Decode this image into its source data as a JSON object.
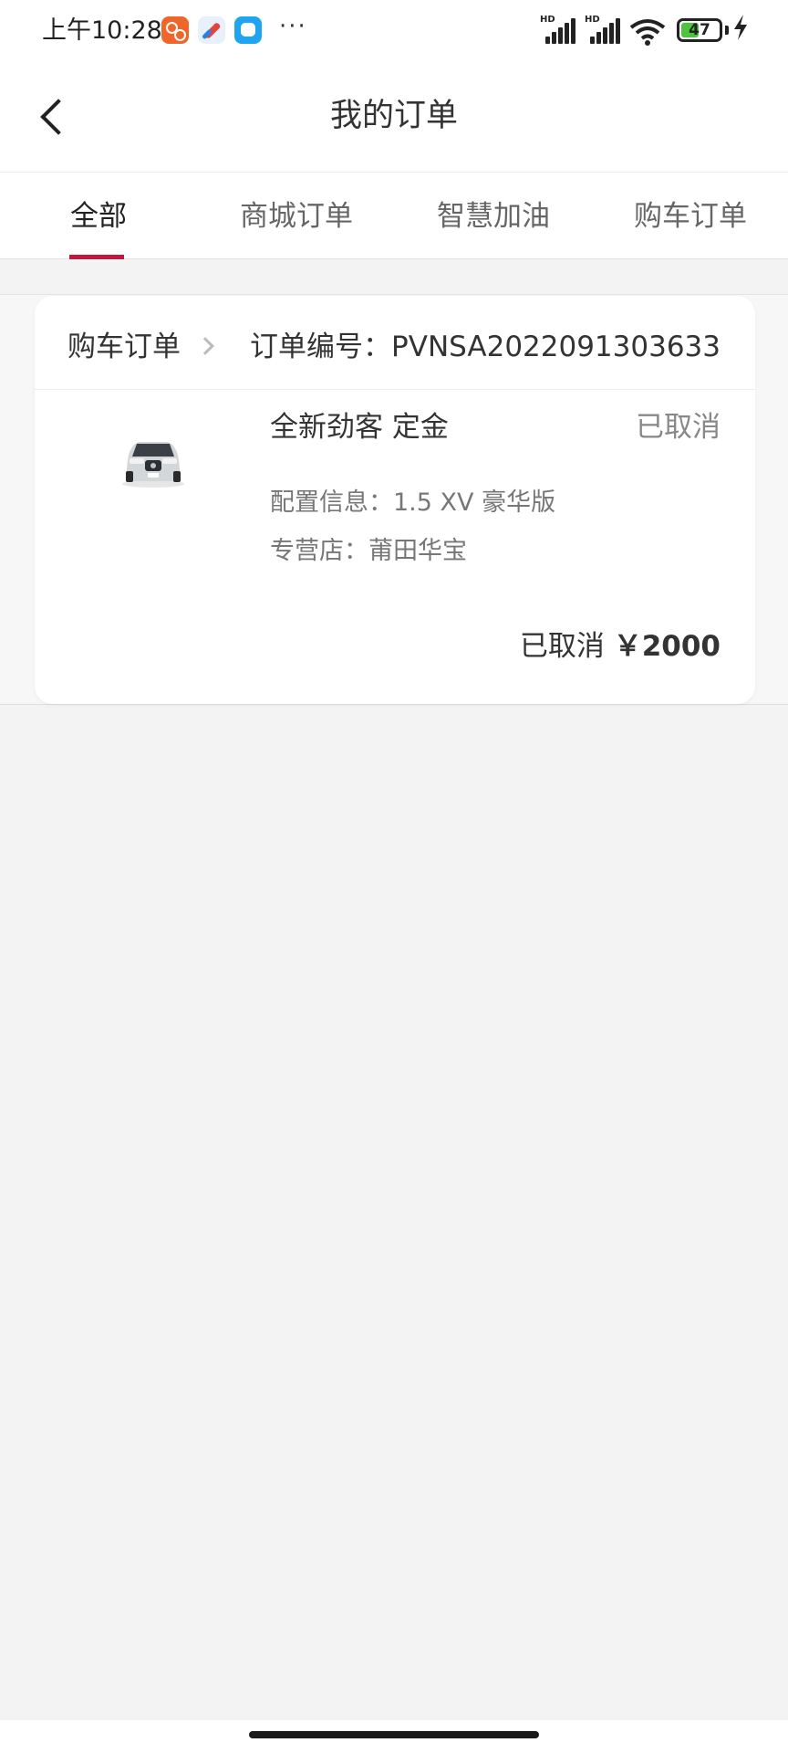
{
  "status_bar": {
    "time": "上午10:28",
    "more": "···",
    "network_1": "HD",
    "network_2": "HD",
    "battery_level": "47",
    "battery_fraction": 0.47,
    "icons": [
      "app-red-icon",
      "app-compass-icon",
      "app-chat-icon",
      "signal-icon",
      "signal-icon",
      "wifi-icon",
      "battery-icon",
      "charging-icon"
    ]
  },
  "header": {
    "title": "我的订单",
    "back_icon": "chevron-left-icon"
  },
  "tabs": [
    {
      "label": "全部",
      "active": true
    },
    {
      "label": "商城订单",
      "active": false
    },
    {
      "label": "智慧加油",
      "active": false
    },
    {
      "label": "购车订单",
      "active": false
    }
  ],
  "colors": {
    "accent": "#c4173d",
    "background": "#f3f3f3",
    "card": "#ffffff",
    "battery": "#4cc53c"
  },
  "orders": [
    {
      "type": "购车订单",
      "number": "订单编号：PVNSA2022091303633",
      "product_name": "全新劲客 定金",
      "status": "已取消",
      "config": "配置信息：1.5 XV 豪华版",
      "dealer": "专营店：莆田华宝",
      "total_status": "已取消",
      "total_amount": "￥2000"
    }
  ]
}
